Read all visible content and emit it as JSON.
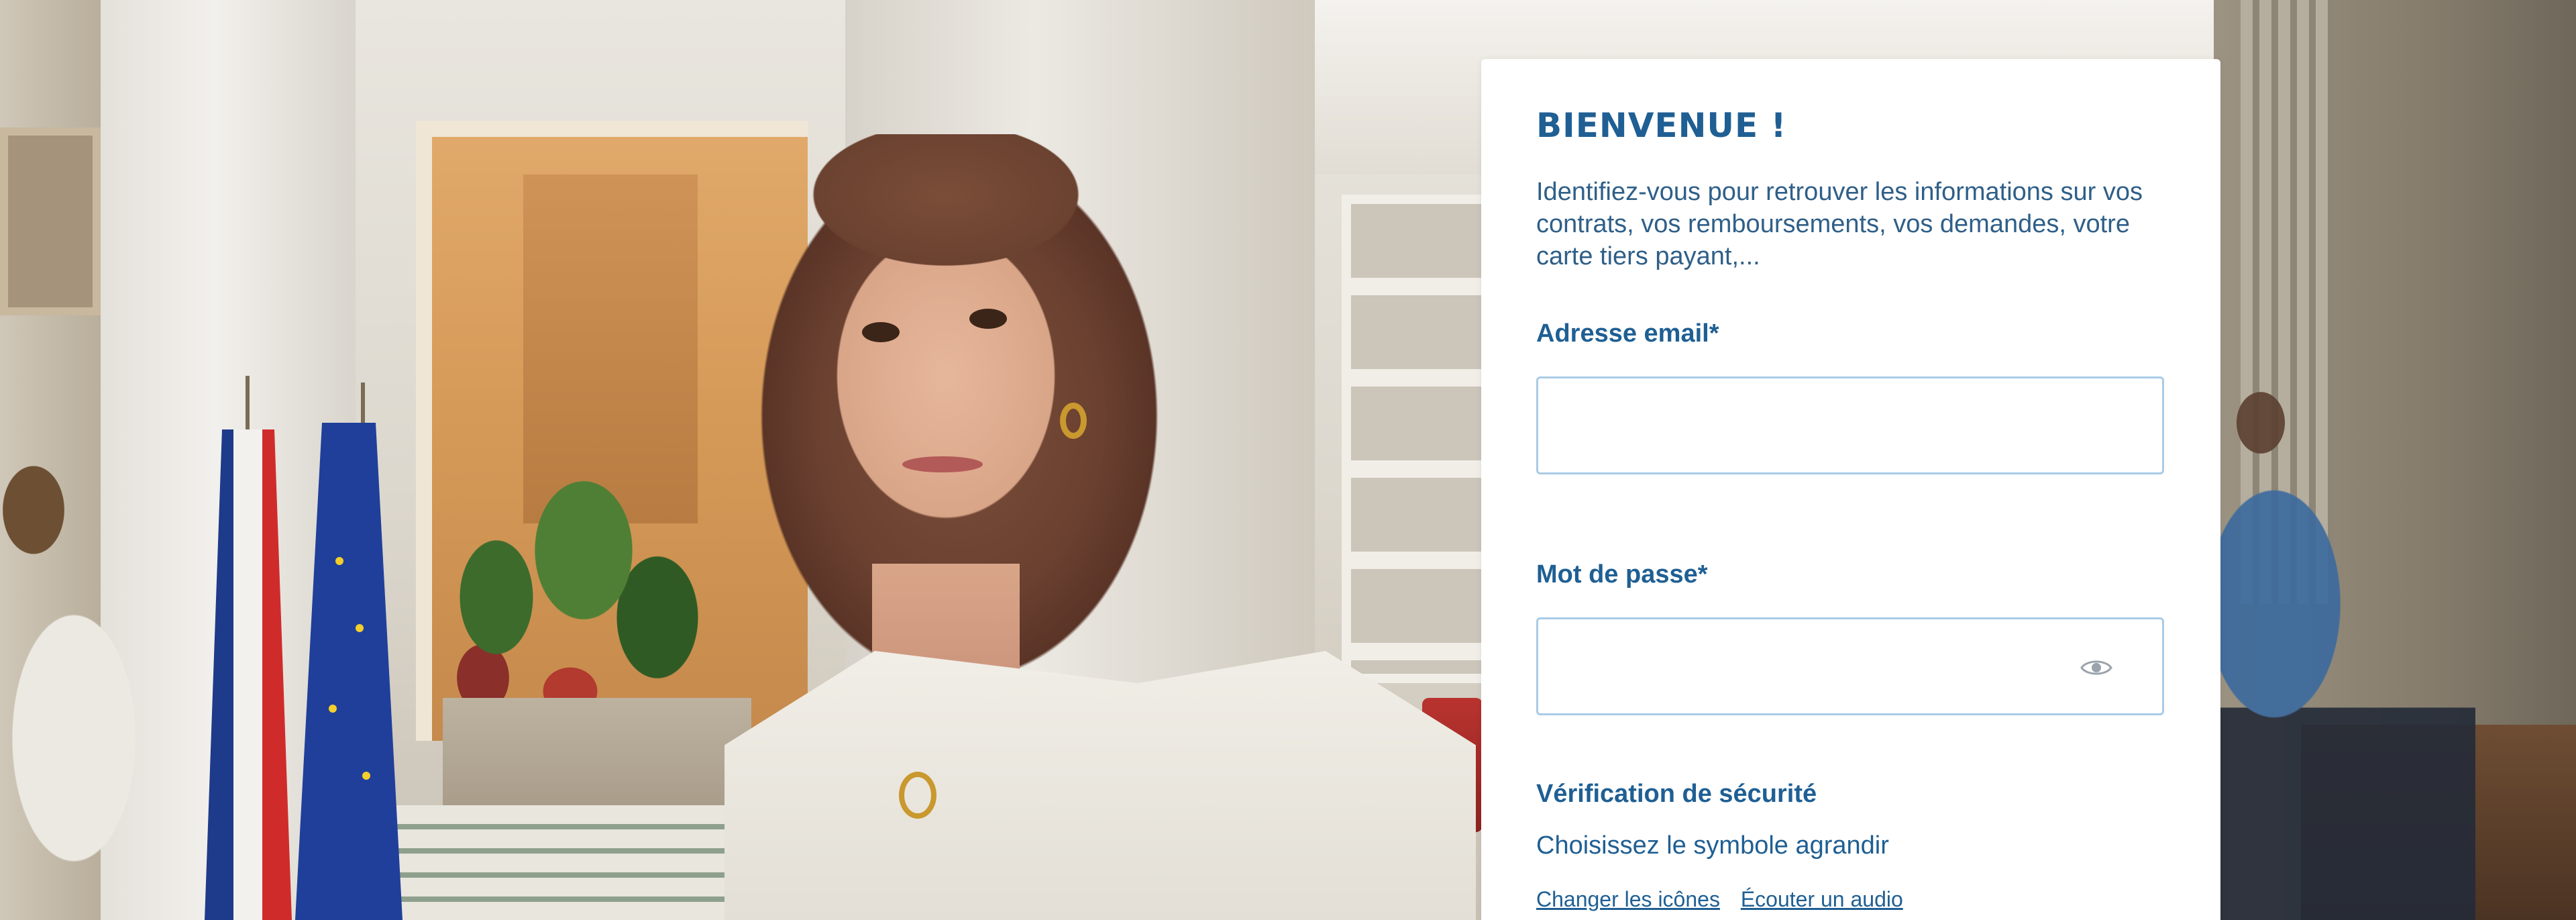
{
  "login": {
    "title": "BIENVENUE !",
    "intro": "Identifiez-vous pour retrouver les informations sur vos contrats, vos remboursements, vos demandes, votre carte tiers payant,...",
    "email_label": "Adresse email*",
    "email_value": "",
    "password_label": "Mot de passe*",
    "password_value": "",
    "password_toggle_icon": "eye-icon",
    "security_title": "Vérification de sécurité",
    "security_instruction": "Choisissez le symbole agrandir",
    "captcha_links": [
      "Changer les icônes",
      "Écouter un audio"
    ]
  },
  "colors": {
    "accent": "#1f5f93",
    "input_border": "#a9cbe6",
    "card_background": "#ffffff"
  }
}
